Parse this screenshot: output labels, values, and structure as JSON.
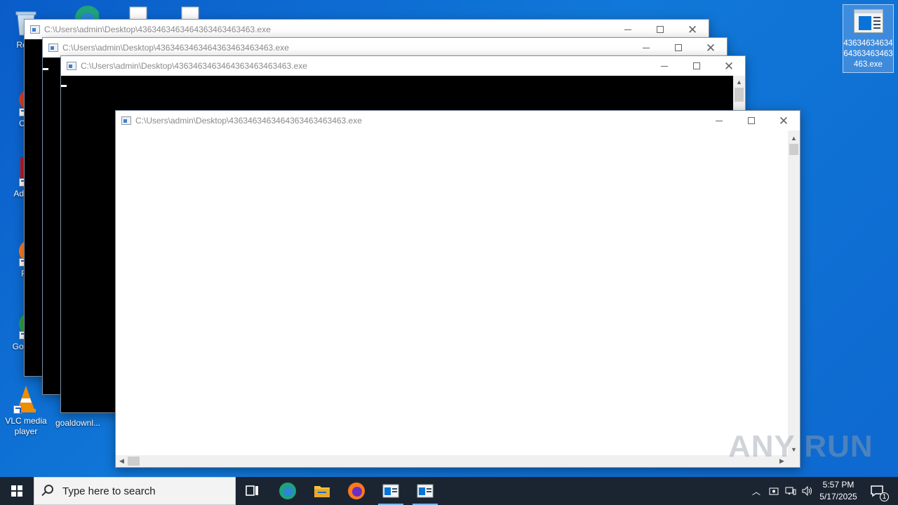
{
  "desktop": {
    "icons": [
      {
        "label": "Recy"
      },
      {
        "label": "CCl"
      },
      {
        "label": "Ad Acr"
      },
      {
        "label": "Fir"
      },
      {
        "label": "Go Chr"
      },
      {
        "label": "VLC media player"
      },
      {
        "label": "goaldownl..."
      }
    ],
    "selected_exe_label": "4363463463464363463463463.exe"
  },
  "windows": [
    {
      "title": "C:\\Users\\admin\\Desktop\\4363463463464363463463463.exe"
    },
    {
      "title": "C:\\Users\\admin\\Desktop\\4363463463464363463463463.exe"
    },
    {
      "title": "C:\\Users\\admin\\Desktop\\4363463463464363463463463.exe"
    },
    {
      "title": "C:\\Users\\admin\\Desktop\\4363463463464363463463463.exe"
    }
  ],
  "taskbar": {
    "search_placeholder": "Type here to search",
    "time": "5:57 PM",
    "date": "5/17/2025",
    "notification_count": "1"
  },
  "watermark": "ANY RUN"
}
